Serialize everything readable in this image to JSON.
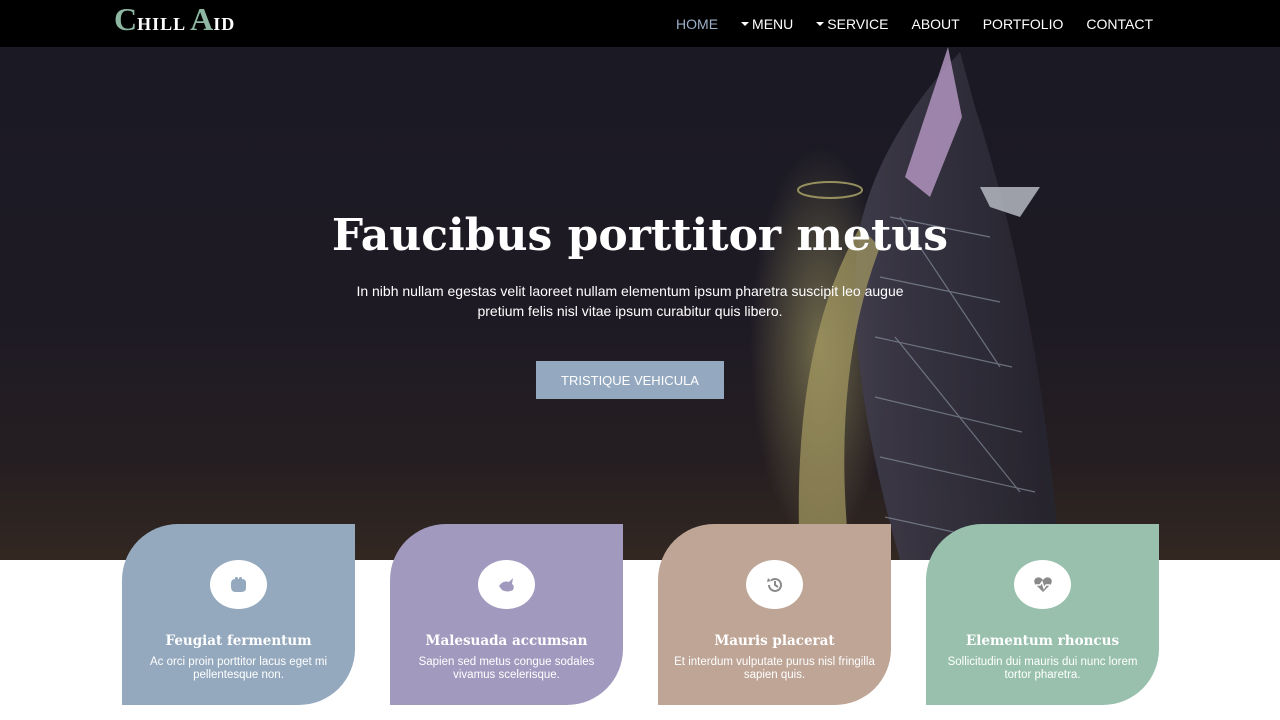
{
  "brand": {
    "letter1": "C",
    "rest1": "HILL",
    "letter2": "A",
    "rest2": "ID"
  },
  "nav": {
    "items": [
      {
        "label": "HOME"
      },
      {
        "label": "MENU"
      },
      {
        "label": "SERVICE"
      },
      {
        "label": "ABOUT"
      },
      {
        "label": "PORTFOLIO"
      },
      {
        "label": "CONTACT"
      }
    ]
  },
  "hero": {
    "title": "Faucibus porttitor metus",
    "subtitle": "In nibh nullam egestas velit laoreet nullam elementum ipsum pharetra suscipit leo augue pretium felis nisl vitae ipsum curabitur quis libero.",
    "button": "TRISTIQUE VEHICULA"
  },
  "features": [
    {
      "title": "Feugiat fermentum",
      "desc": "Ac orci proin porttitor lacus eget mi pellentesque non.",
      "icon": "hand-icon",
      "color": "#94a9be"
    },
    {
      "title": "Malesuada accumsan",
      "desc": "Sapien sed metus congue sodales vivamus scelerisque.",
      "icon": "dove-icon",
      "color": "#a29abe"
    },
    {
      "title": "Mauris placerat",
      "desc": "Et interdum vulputate purus nisl fringilla sapien quis.",
      "icon": "history-icon",
      "color": "#bea596"
    },
    {
      "title": "Elementum rhoncus",
      "desc": "Sollicitudin dui mauris dui nunc lorem tortor pharetra.",
      "icon": "heartbeat-icon",
      "color": "#98c0ad"
    }
  ]
}
